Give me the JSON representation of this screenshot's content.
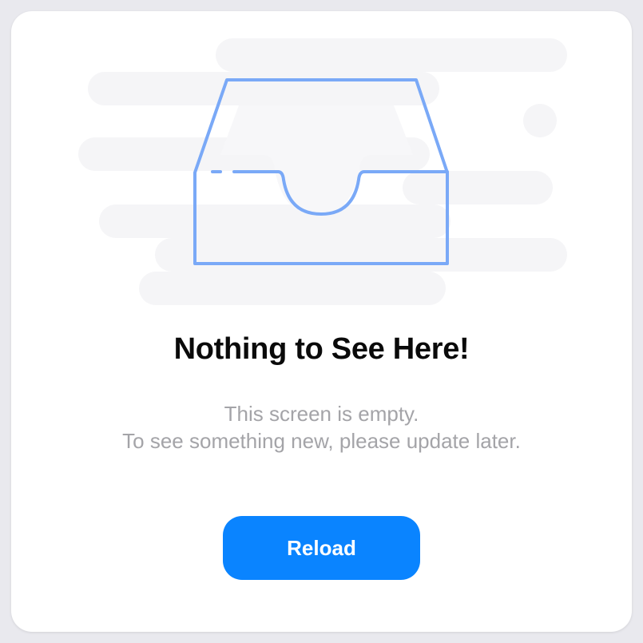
{
  "empty_state": {
    "title": "Nothing to See Here!",
    "message_line1": "This screen is empty.",
    "message_line2": "To see something new, please update later.",
    "icon": "empty-inbox-tray-icon"
  },
  "actions": {
    "reload_label": "Reload"
  },
  "colors": {
    "accent": "#0a84ff",
    "icon_stroke": "#7aa9f7",
    "title": "#0a0a0a",
    "message": "#a4a4a8",
    "background_shapes": "#f5f5f7"
  }
}
